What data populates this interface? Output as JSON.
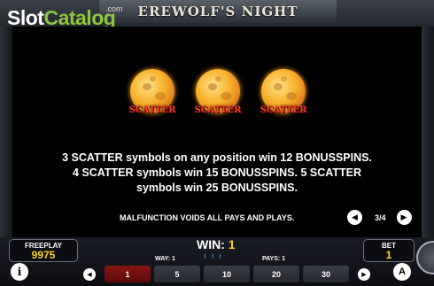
{
  "header": {
    "game_title": "EREWOLF'S NIGHT",
    "logo_part1": "Slot",
    "logo_part2": "Catalog",
    "logo_suffix": ".com"
  },
  "paytable": {
    "symbol_label": "SCATTER",
    "symbol_count": 3,
    "description_line1": "3 SCATTER symbols on any position win 12 BONUSSPINS.",
    "description_line2": "4 SCATTER symbols win 15 BONUSSPINS. 5 SCATTER",
    "description_line3": "symbols win 25 BONUSSPINS.",
    "malfunction": "MALFUNCTION VOIDS ALL PAYS AND PLAYS.",
    "page": "3/4",
    "prev_icon": "chevron-left-icon",
    "next_icon": "chevron-right-icon"
  },
  "bottom_bar": {
    "freeplay_label": "FREEPLAY",
    "freeplay_value": "9975",
    "win_label": "WIN:",
    "win_value": "1",
    "way_label": "WAY: 1",
    "pays_label": "PAYS: 1",
    "bet_label": "BET",
    "bet_value": "1",
    "bet_options": [
      "1",
      "5",
      "10",
      "20",
      "30"
    ],
    "selected_bet": "1",
    "info_label": "i",
    "autoplay_label": "A"
  },
  "colors": {
    "accent_yellow": "#ffd21f",
    "scatter_red": "#ff3b1f",
    "selected_bet": "#8a1414",
    "logo_green": "#8cc63f"
  }
}
